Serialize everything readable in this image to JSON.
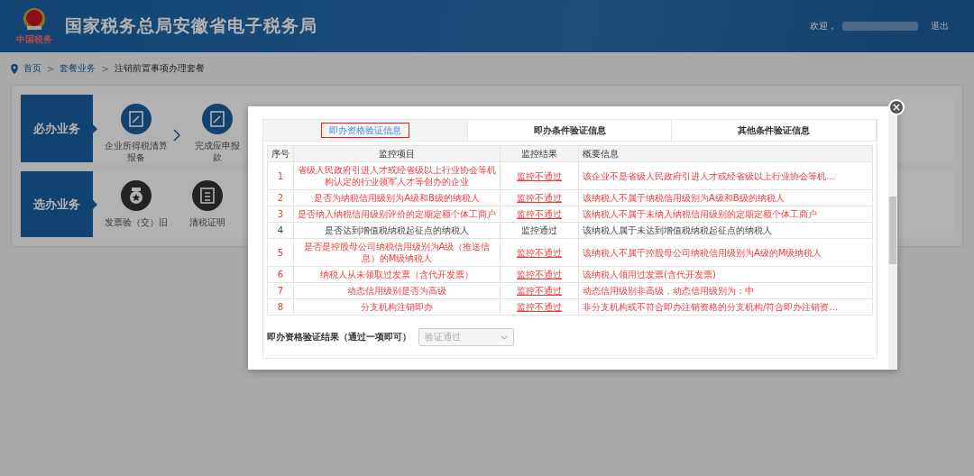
{
  "header": {
    "title": "国家税务总局安徽省电子税务局",
    "logo_caption": "中国税务",
    "welcome": "欢迎，",
    "logout": "退出"
  },
  "breadcrumb": [
    {
      "label": "首页",
      "link": true
    },
    {
      "separator": ">",
      "label": "套餐业务",
      "link": true
    },
    {
      "separator": ">",
      "label": "注销前置事项办理套餐",
      "link": false
    }
  ],
  "sections": [
    {
      "title": "必办业务",
      "items": [
        {
          "kind": "edit",
          "lines": [
            "企业所得税清算",
            "报备"
          ]
        },
        {
          "kind": "edit",
          "lines": [
            "完成应申报",
            "款"
          ]
        }
      ]
    },
    {
      "title": "选办业务",
      "items": [
        {
          "kind": "medal",
          "lines": [
            "发票验（交）旧"
          ]
        },
        {
          "kind": "certificate",
          "lines": [
            "清税证明"
          ]
        }
      ]
    }
  ],
  "dialog": {
    "tabs": [
      {
        "label": "即办资格验证信息",
        "selected": true
      },
      {
        "label": "即办条件验证信息",
        "selected": false
      },
      {
        "label": "其他条件验证信息",
        "selected": false
      }
    ],
    "table": {
      "columns": [
        "序号",
        "监控项目",
        "监控结果",
        "概要信息"
      ],
      "rows": [
        {
          "no": "1",
          "item": "省级人民政府引进人才或经省级以上行业协会等机构认定的行业领军人才等创办的企业",
          "result": "监控不通过",
          "summary": "该企业不是省级人民政府引进人才或经省级以上行业协会等机…",
          "passed": false
        },
        {
          "no": "2",
          "item": "是否为纳税信用级别为A级和B级的纳税人",
          "result": "监控不通过",
          "summary": "该纳税人不属于纳税信用级别为A级和B级的纳税人",
          "passed": false
        },
        {
          "no": "3",
          "item": "是否纳入纳税信用级别评价的定期定额个体工商户",
          "result": "监控不通过",
          "summary": "该纳税人不属于未纳入纳税信用级别的定期定额个体工商户",
          "passed": false
        },
        {
          "no": "4",
          "item": "是否达到增值税纳税起征点的纳税人",
          "result": "监控通过",
          "summary": "该纳税人属于未达到增值税纳税起征点的纳税人",
          "passed": true
        },
        {
          "no": "5",
          "item": "是否是控股母公司纳税信用级别为A级（推送信息）的M级纳税人",
          "result": "监控不通过",
          "summary": "该纳税人不属于控股母公司纳税信用级别为A级的M级纳税人",
          "passed": false
        },
        {
          "no": "6",
          "item": "纳税人从未领取过发票（含代开发票）",
          "result": "监控不通过",
          "summary": "该纳税人领用过发票(含代开发票)",
          "passed": false
        },
        {
          "no": "7",
          "item": "动态信用级别是否为高级",
          "result": "监控不通过",
          "summary": "动态信用级别非高级，动态信用级别为：中",
          "passed": false
        },
        {
          "no": "8",
          "item": "分支机构注销即办",
          "result": "监控不通过",
          "summary": "非分支机构或不符合即办注销资格的分支机构/符合即办注销资…",
          "passed": false
        }
      ]
    },
    "result_field": {
      "label": "即办资格验证结果（通过一项即可）",
      "value": "验证通过",
      "disabled": true
    }
  }
}
